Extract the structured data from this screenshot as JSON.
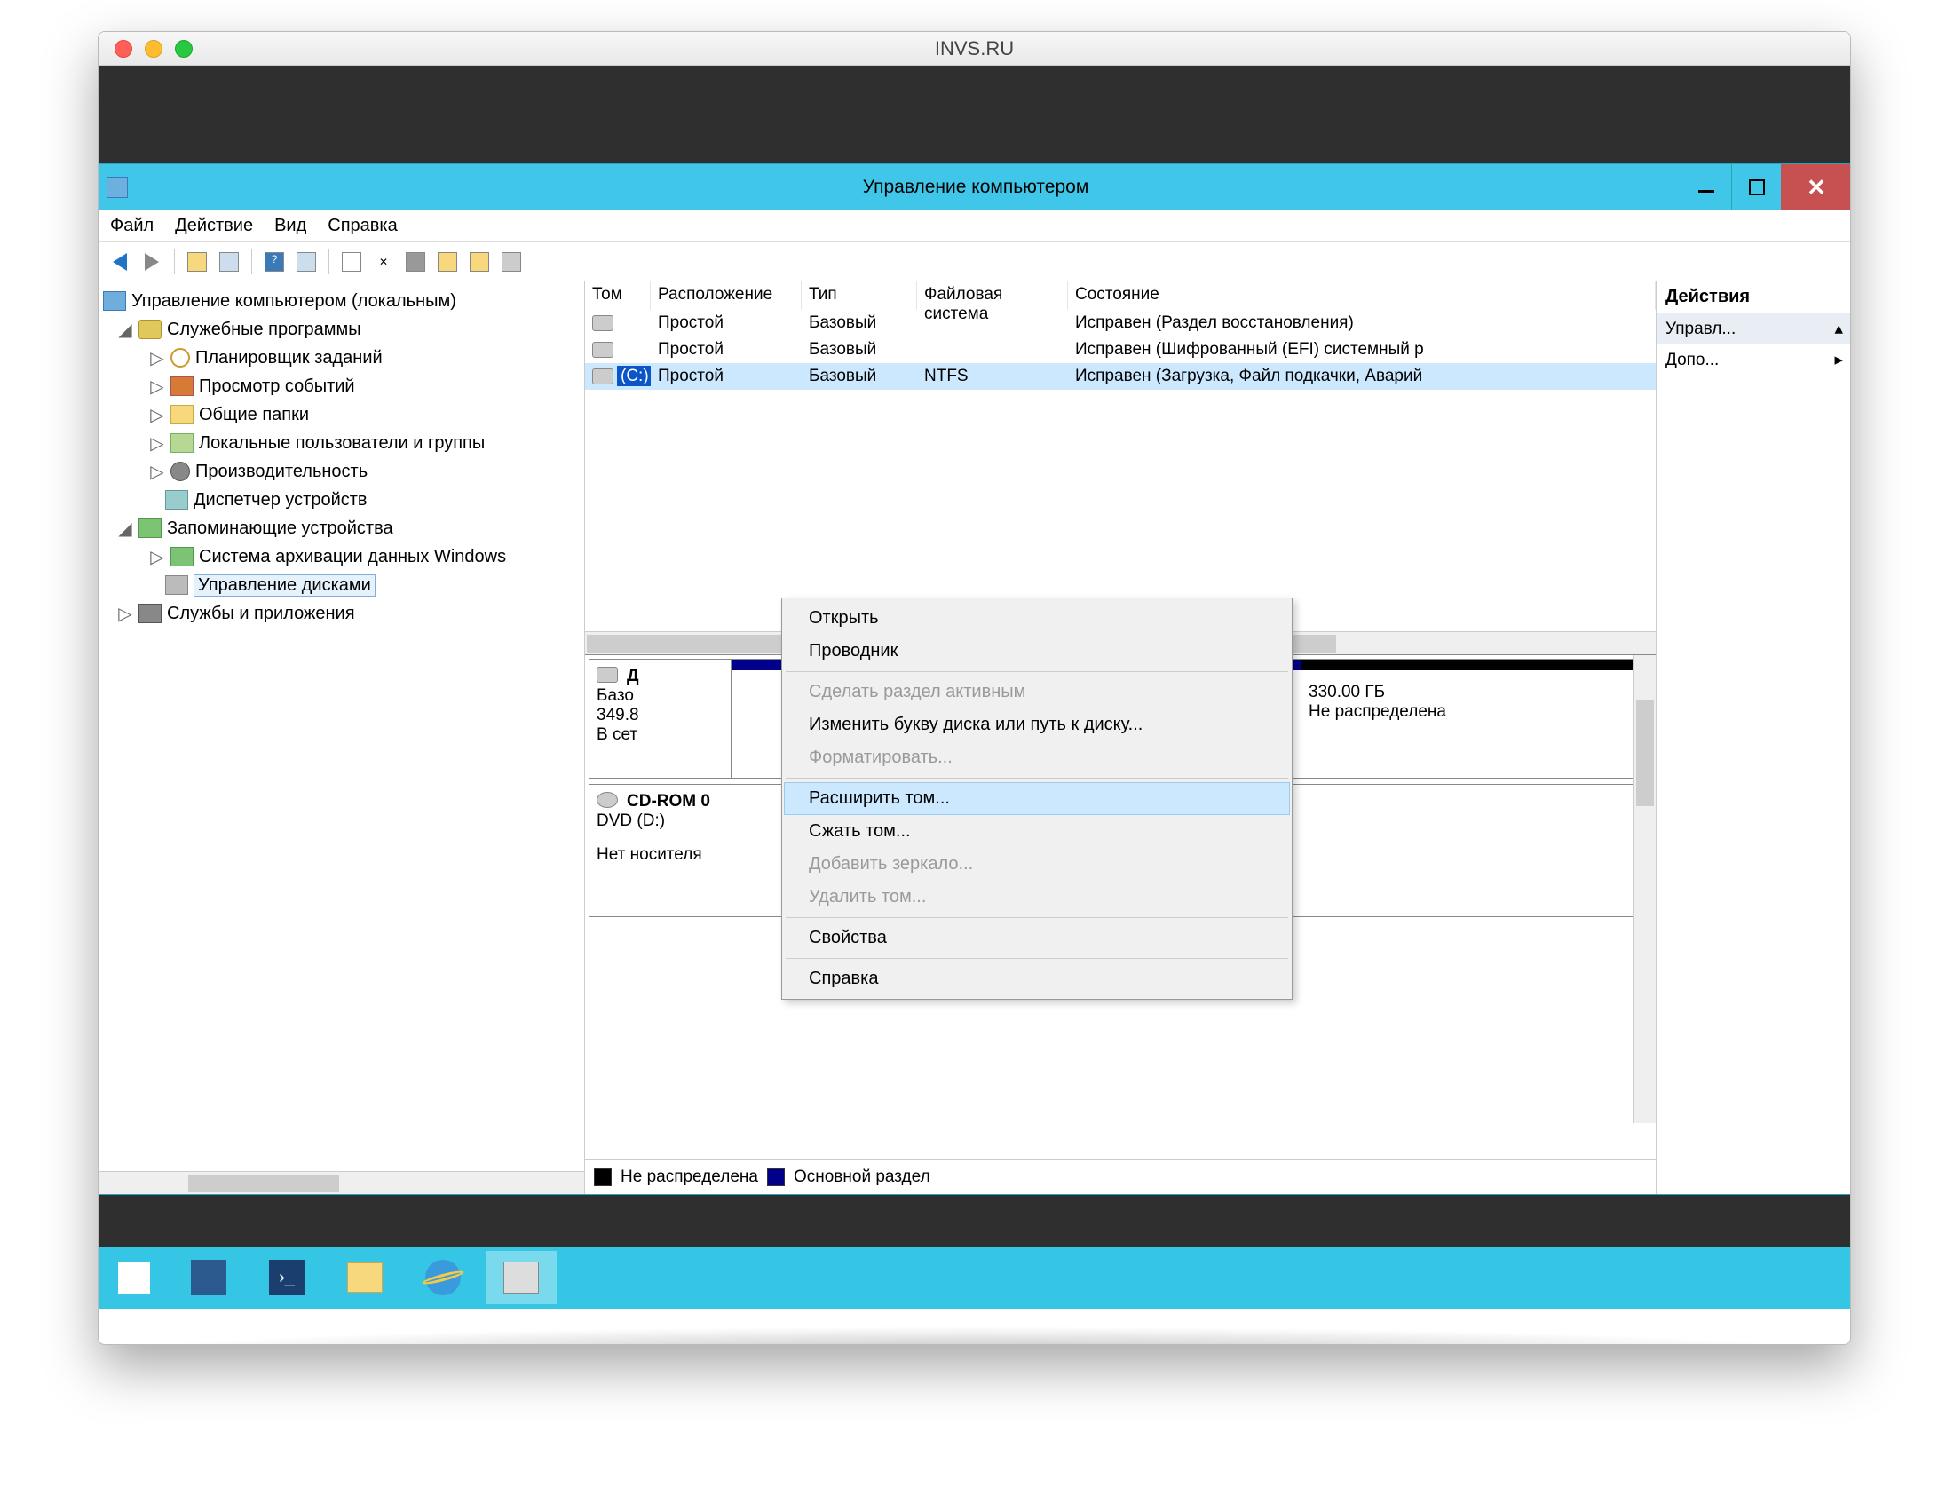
{
  "mac": {
    "title": "INVS.RU"
  },
  "win": {
    "title": "Управление компьютером",
    "menu": [
      "Файл",
      "Действие",
      "Вид",
      "Справка"
    ]
  },
  "tree": {
    "root": "Управление компьютером (локальным)",
    "util": "Служебные программы",
    "util_items": [
      "Планировщик заданий",
      "Просмотр событий",
      "Общие папки",
      "Локальные пользователи и группы",
      "Производительность",
      "Диспетчер устройств"
    ],
    "storage": "Запоминающие устройства",
    "storage_items": [
      "Система архивации данных Windows",
      "Управление дисками"
    ],
    "services": "Службы и приложения"
  },
  "volumes": {
    "headers": {
      "vol": "Том",
      "layout": "Расположение",
      "type": "Тип",
      "fs": "Файловая система",
      "status": "Состояние"
    },
    "rows": [
      {
        "vol": "",
        "layout": "Простой",
        "type": "Базовый",
        "fs": "",
        "status": "Исправен (Раздел восстановления)"
      },
      {
        "vol": "",
        "layout": "Простой",
        "type": "Базовый",
        "fs": "",
        "status": "Исправен (Шифрованный (EFI) системный р"
      },
      {
        "vol": "(C:)",
        "layout": "Простой",
        "type": "Базовый",
        "fs": "NTFS",
        "status": "Исправен (Загрузка, Файл подкачки, Аварий"
      }
    ]
  },
  "ctx": {
    "open": "Открыть",
    "explorer": "Проводник",
    "active": "Сделать раздел активным",
    "change_letter": "Изменить букву диска или путь к диску...",
    "format": "Форматировать...",
    "extend": "Расширить том...",
    "shrink": "Сжать том...",
    "mirror": "Добавить зеркало...",
    "delete": "Удалить том...",
    "props": "Свойства",
    "help": "Справка"
  },
  "disks": {
    "disk0": {
      "name": "Д",
      "type": "Базо",
      "size": "349.8",
      "status": "В сет"
    },
    "unalloc": {
      "size": "330.00 ГБ",
      "label": "Не распределена"
    },
    "cdrom": {
      "name": "CD-ROM 0",
      "dev": "DVD (D:)",
      "status": "Нет носителя"
    }
  },
  "legend": {
    "unalloc": "Не распределена",
    "primary": "Основной раздел"
  },
  "actions": {
    "header": "Действия",
    "item1": "Управл...",
    "item2": "Допо..."
  }
}
